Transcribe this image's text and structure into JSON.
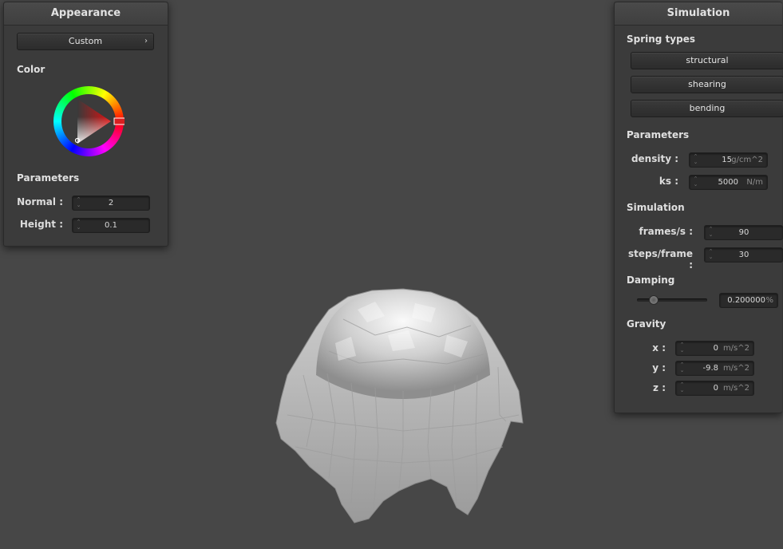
{
  "appearance": {
    "title": "Appearance",
    "preset_label": "Custom",
    "color_heading": "Color",
    "params_heading": "Parameters",
    "normal_label": "Normal :",
    "normal_value": "2",
    "height_label": "Height :",
    "height_value": "0.1"
  },
  "simulation": {
    "title": "Simulation",
    "spring_types_heading": "Spring types",
    "spring_types": [
      "structural",
      "shearing",
      "bending"
    ],
    "params_heading": "Parameters",
    "density_label": "density :",
    "density_value": "15",
    "density_unit": "g/cm^2",
    "ks_label": "ks :",
    "ks_value": "5000",
    "ks_unit": "N/m",
    "sim_heading": "Simulation",
    "fps_label": "frames/s :",
    "fps_value": "90",
    "steps_label": "steps/frame :",
    "steps_value": "30",
    "damping_heading": "Damping",
    "damping_value": "0.200000",
    "damping_unit": "%",
    "damping_slider_fraction": 0.2,
    "gravity_heading": "Gravity",
    "gx_label": "x :",
    "gx_value": "0",
    "gy_label": "y :",
    "gy_value": "-9.8",
    "gz_label": "z :",
    "gz_value": "0",
    "gravity_unit": "m/s^2"
  },
  "colors": {
    "background": "#474747",
    "panel": "#3b3b3b",
    "accent_red": "#e02020"
  }
}
